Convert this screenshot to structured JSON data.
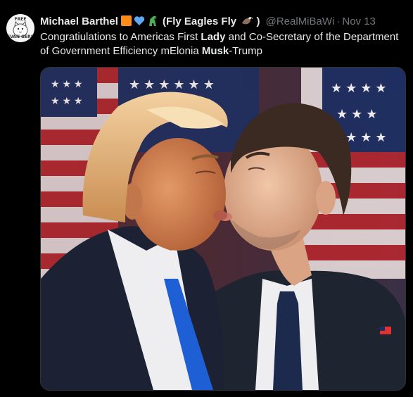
{
  "author": {
    "display_name": "Michael Barthel",
    "name_suffix": "(Fly Eagles Fly",
    "name_close": ")",
    "handle": "@RealMiBaWi",
    "separator": "·",
    "timestamp": "Nov 13",
    "avatar_text_top": "FREE",
    "avatar_text_bottom": "EVAN GERS",
    "emoji": [
      "orange-square-icon",
      "blue-heart-icon",
      "dinosaur-icon",
      "eagle-icon"
    ]
  },
  "tweet": {
    "text_part1": "Congratiulations to Americas First ",
    "text_bold1": "Lady",
    "text_part2": " and Co-Secretary of the Department of Government Efficiency mElonia ",
    "text_bold2": "Musk",
    "text_part3": "-Trump"
  },
  "colors": {
    "background": "#000000",
    "text": "#e7e9ea",
    "muted": "#71767b",
    "orange_emoji": "#ff8c1a",
    "blue_heart": "#5fa8f5",
    "dino": "#4caf50",
    "tie_blue": "#1f5fd6",
    "tie_navy": "#1b2a4d"
  }
}
